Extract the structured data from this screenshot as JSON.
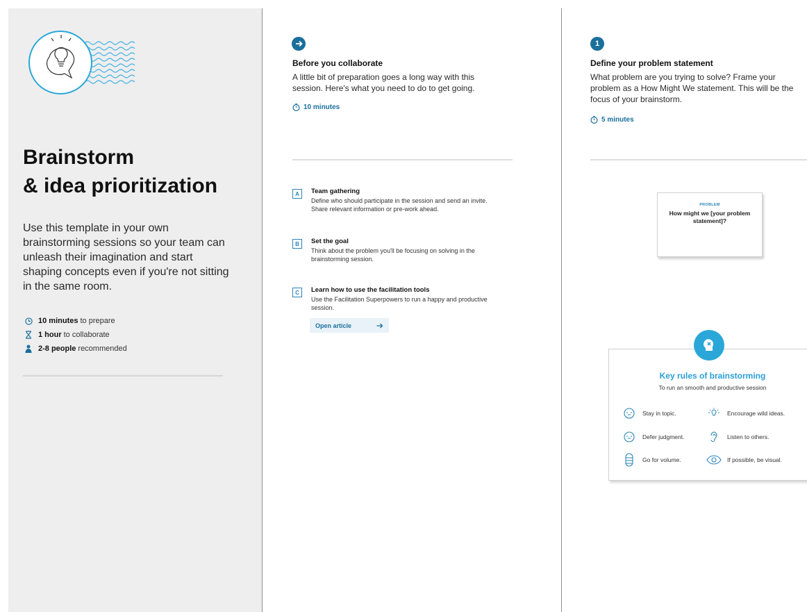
{
  "intro": {
    "title_line1": "Brainstorm",
    "title_line2": "& idea prioritization",
    "description": "Use this template in your own brainstorming sessions so your team can unleash their imagination and start shaping concepts even if you're not sitting in the same room.",
    "meta": [
      {
        "icon": "clock-icon",
        "bold": "10 minutes",
        "rest": "to prepare"
      },
      {
        "icon": "hourglass-icon",
        "bold": "1 hour",
        "rest": "to collaborate"
      },
      {
        "icon": "person-icon",
        "bold": "2-8 people",
        "rest": "recommended"
      }
    ]
  },
  "before": {
    "title": "Before you collaborate",
    "description": "A little bit of preparation goes a long way with this session. Here's what you need to do to get going.",
    "time": "10 minutes",
    "tasks": [
      {
        "letter": "A",
        "title": "Team gathering",
        "desc": "Define who should participate in the session and send an invite. Share relevant information or pre-work ahead."
      },
      {
        "letter": "B",
        "title": "Set the goal",
        "desc": "Think about the problem you'll be focusing on solving in the brainstorming session."
      },
      {
        "letter": "C",
        "title": "Learn how to use the facilitation tools",
        "desc": "Use the Facilitation Superpowers to run a happy and productive session."
      }
    ],
    "open_article": "Open article"
  },
  "step1": {
    "number": "1",
    "title": "Define your problem statement",
    "description": "What problem are you trying to solve? Frame your problem as a How Might We statement. This will be the focus of your brainstorm.",
    "time": "5 minutes",
    "card_label": "PROBLEM",
    "card_text": "How might we [your problem statement]?"
  },
  "rules": {
    "title": "Key rules of brainstorming",
    "subtitle": "To run an smooth and productive session",
    "items": [
      {
        "label": "Stay in topic.",
        "icon": "face-icon"
      },
      {
        "label": "Encourage wild ideas.",
        "icon": "lightbulb-icon"
      },
      {
        "label": "Defer judgment.",
        "icon": "face-icon"
      },
      {
        "label": "Listen to others.",
        "icon": "ear-icon"
      },
      {
        "label": "Go for volume.",
        "icon": "stack-icon"
      },
      {
        "label": "If possible, be visual.",
        "icon": "eye-icon"
      }
    ]
  },
  "colors": {
    "accent": "#1a6f9b",
    "rules_accent": "#2aa7d8",
    "panel": "#eeeeef"
  }
}
